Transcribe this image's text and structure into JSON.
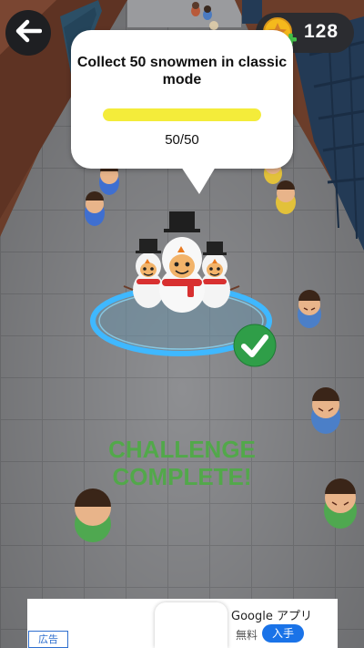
{
  "hud": {
    "back_icon": "arrow-left-icon",
    "coin_icon": "star-coin-plus-icon",
    "coins": "128"
  },
  "challenge": {
    "title": "Collect 50 snowmen in classic mode",
    "progress_text": "50/50",
    "progress_fraction": 1.0,
    "progress_color": "#f4ec3a"
  },
  "result": {
    "line1": "CHALLENGE",
    "line2": "COMPLETE!",
    "color": "#52a84a",
    "check_icon": "checkmark-icon"
  },
  "ad": {
    "badge": "広告",
    "title": "Google アプリ",
    "price": "無料",
    "action": "入手"
  }
}
